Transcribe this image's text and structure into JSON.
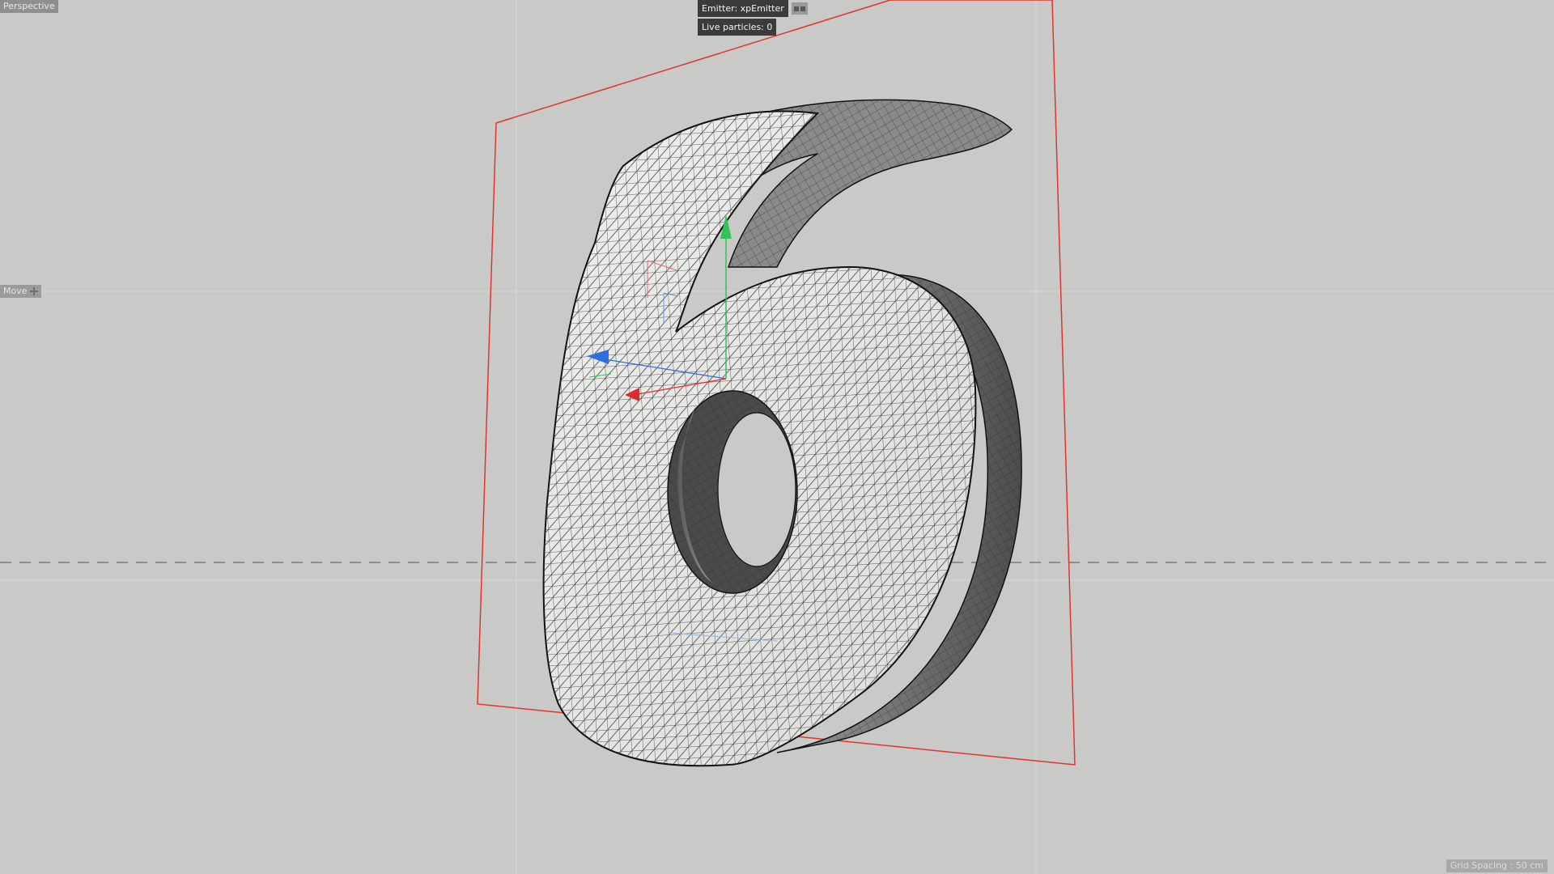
{
  "viewport": {
    "camera_label": "Perspective",
    "tool_label": "Move",
    "tool_icon": "move-cross-icon",
    "grid_spacing": "Grid Spacing : 50 cm",
    "background_color": "#c9c9c7",
    "bounds_color": "#e0352b"
  },
  "hud": {
    "emitter": "Emitter: xpEmitter",
    "live_particles": "Live particles: 0"
  },
  "scene": {
    "object": "digit-six-mesh",
    "axis_colors": {
      "y": "#2fc45a",
      "z": "#2a6fe0",
      "x": "#e02a2a"
    }
  }
}
